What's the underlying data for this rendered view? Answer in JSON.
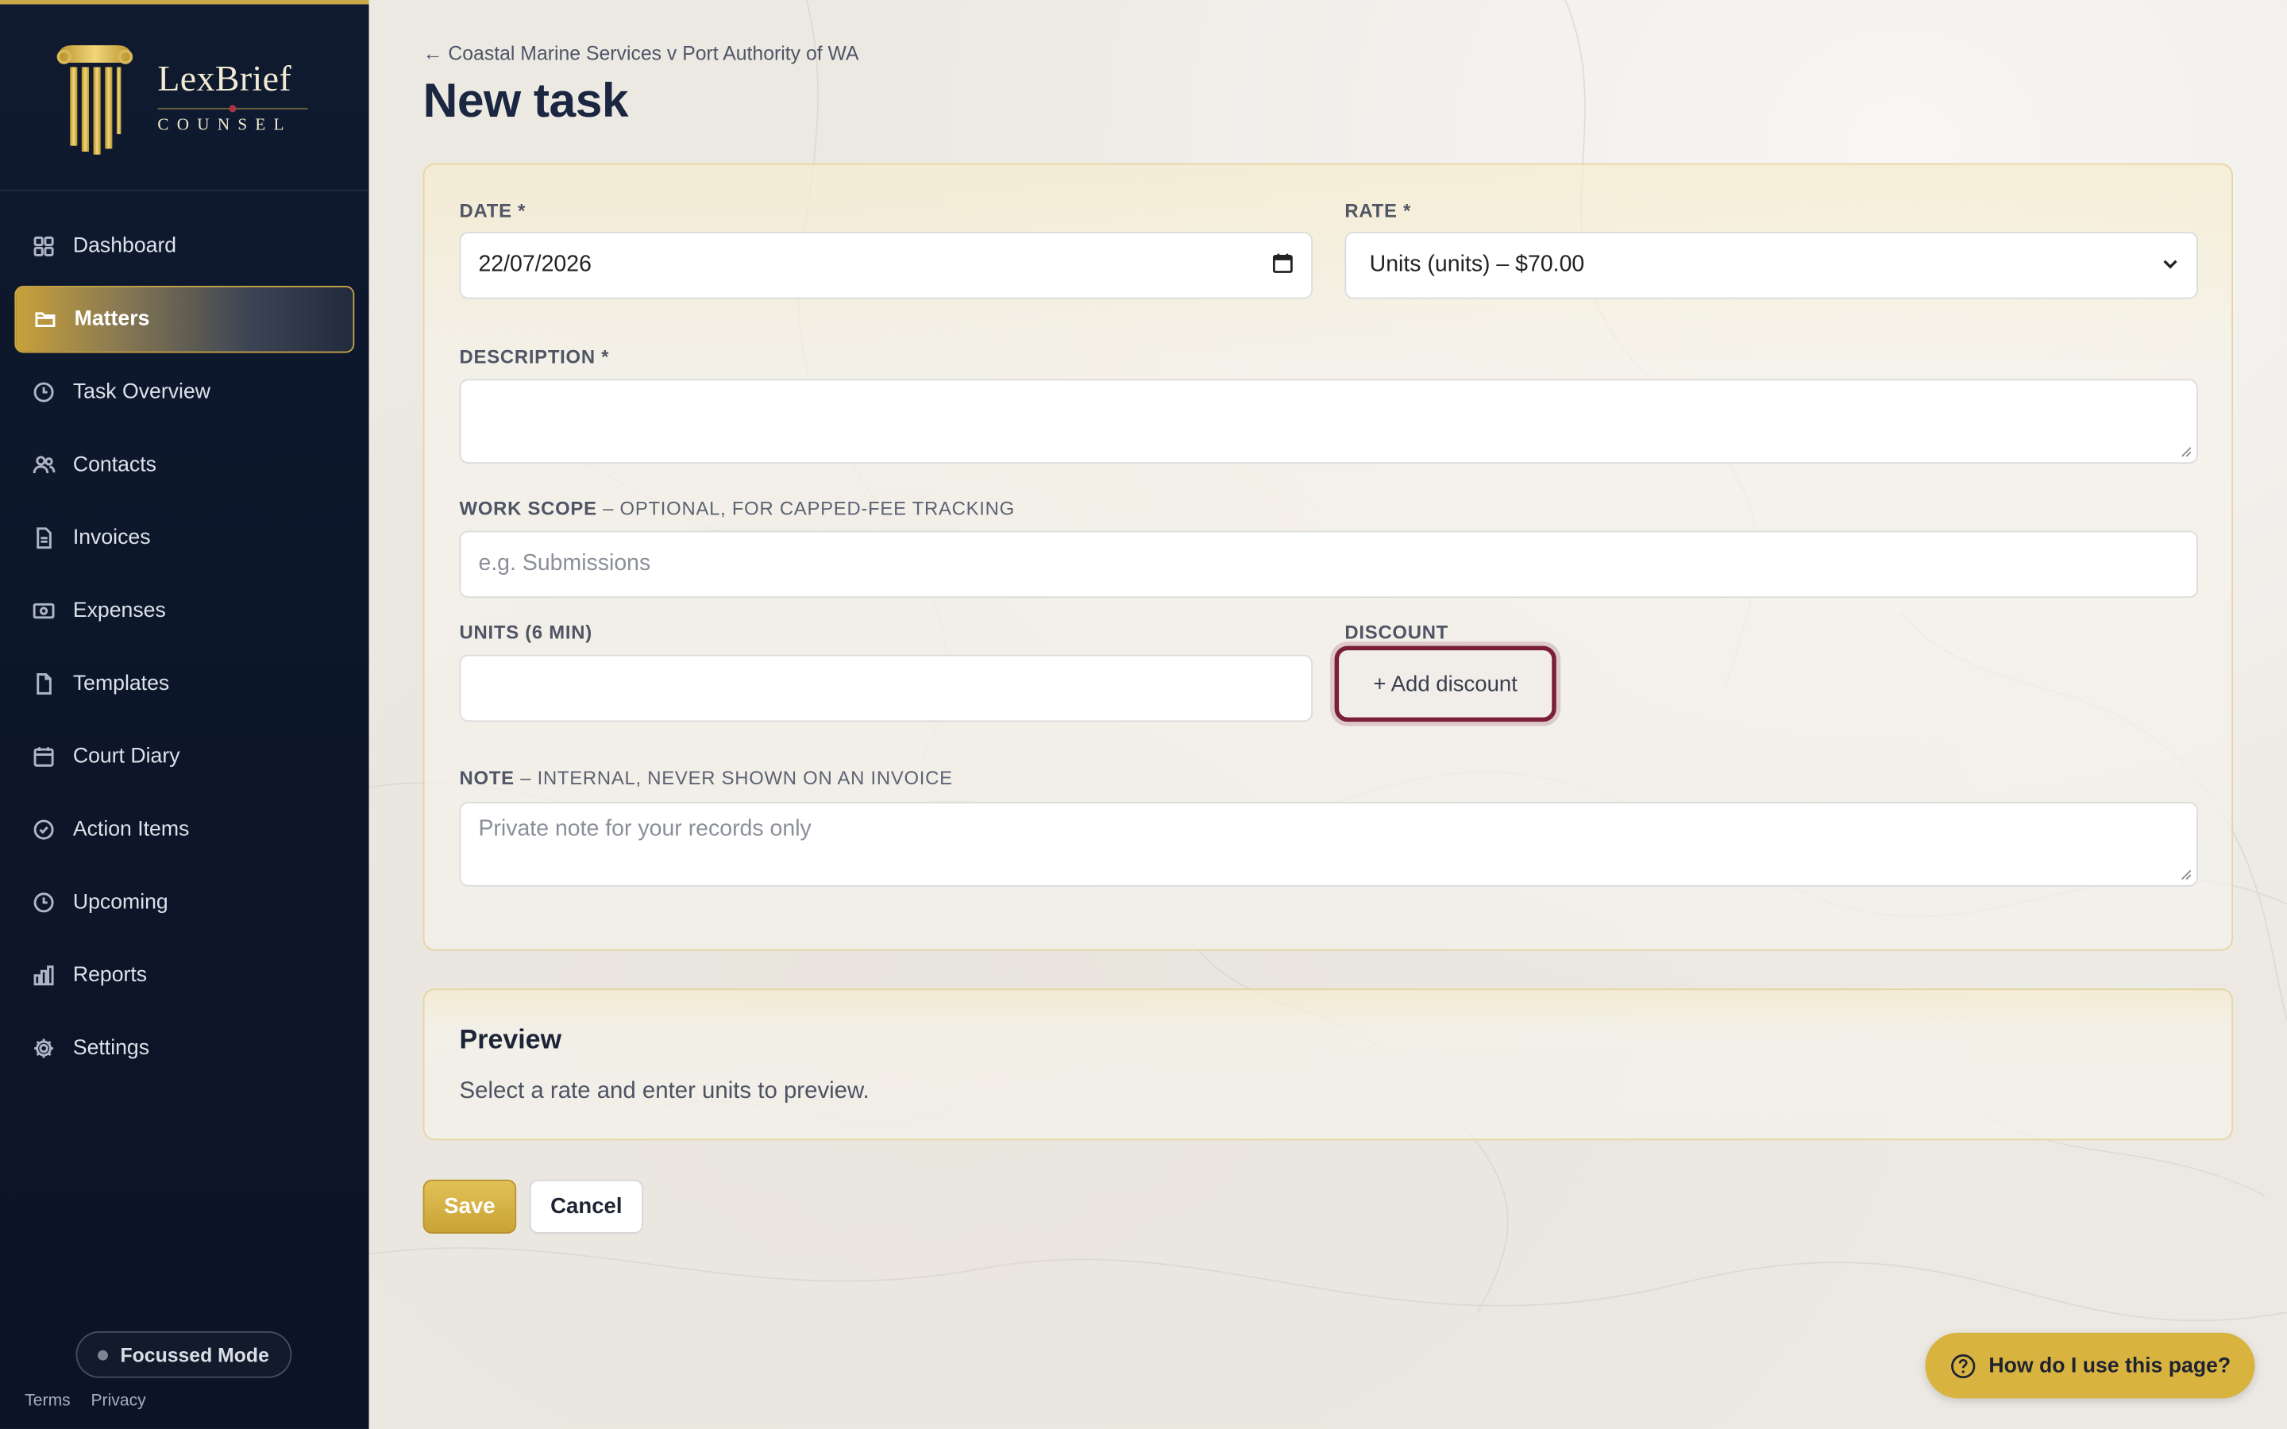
{
  "brand": {
    "name": "LexBrief",
    "sub": "COUNSEL",
    "accent": "#c9a94a"
  },
  "sidebar": {
    "items": [
      {
        "label": "Dashboard",
        "icon": "grid-icon"
      },
      {
        "label": "Matters",
        "icon": "folder-icon",
        "active": true
      },
      {
        "label": "Task Overview",
        "icon": "clock-icon"
      },
      {
        "label": "Contacts",
        "icon": "users-icon"
      },
      {
        "label": "Invoices",
        "icon": "document-icon"
      },
      {
        "label": "Expenses",
        "icon": "banknote-icon"
      },
      {
        "label": "Templates",
        "icon": "file-icon"
      },
      {
        "label": "Court Diary",
        "icon": "calendar-icon"
      },
      {
        "label": "Action Items",
        "icon": "check-circle-icon"
      },
      {
        "label": "Upcoming",
        "icon": "clock-icon"
      },
      {
        "label": "Reports",
        "icon": "bar-chart-icon"
      },
      {
        "label": "Settings",
        "icon": "gear-icon"
      }
    ],
    "focus_mode": "Focussed Mode",
    "terms": "Terms",
    "privacy": "Privacy"
  },
  "header": {
    "breadcrumb": "← Coastal Marine Services v Port Authority of WA",
    "title": "New task"
  },
  "form": {
    "date_label": "DATE *",
    "date_value": "22/07/2026",
    "rate_label": "RATE *",
    "rate_value": "Units (units) – $70.00",
    "description_label": "DESCRIPTION *",
    "description_value": "",
    "work_scope_label": "WORK SCOPE",
    "work_scope_hint": " – OPTIONAL, FOR CAPPED-FEE TRACKING",
    "work_scope_placeholder": "e.g. Submissions",
    "units_label": "UNITS (6 MIN)",
    "units_value": "",
    "discount_label": "DISCOUNT",
    "add_discount": "+ Add discount",
    "note_label": "NOTE",
    "note_hint": " – INTERNAL, NEVER SHOWN ON AN INVOICE",
    "note_placeholder": "Private note for your records only"
  },
  "preview": {
    "title": "Preview",
    "text": "Select a rate and enter units to preview."
  },
  "actions": {
    "save": "Save",
    "cancel": "Cancel"
  },
  "help": {
    "label": "How do I use this page?"
  },
  "colors": {
    "sidebar_bg": "#0f1a30",
    "gold": "#c9a234",
    "focus_ring": "#7b1f36"
  }
}
